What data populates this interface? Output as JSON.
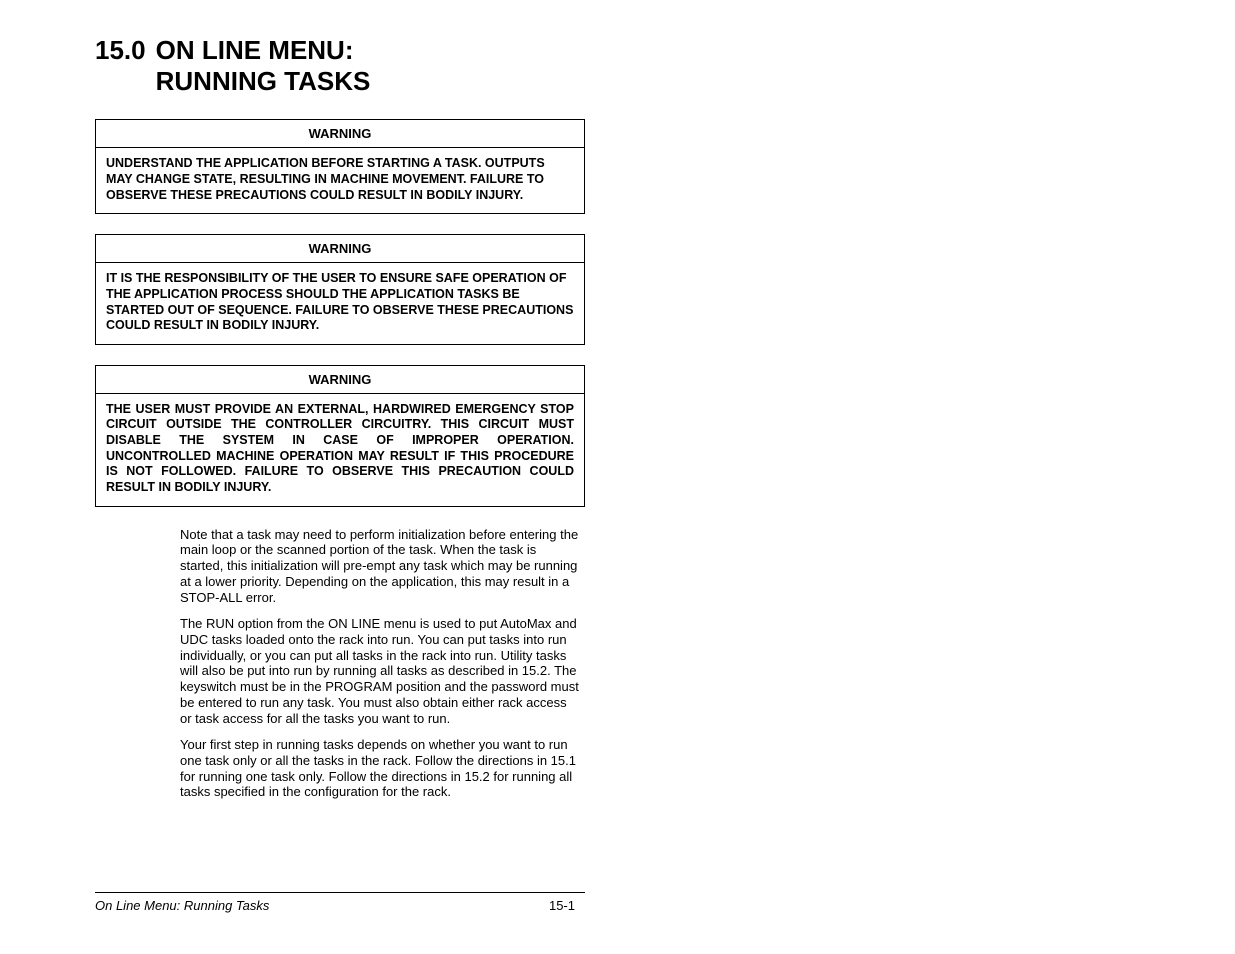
{
  "header": {
    "number": "15.0",
    "title_line1": "ON LINE MENU:",
    "title_line2": "RUNNING TASKS"
  },
  "warnings": [
    {
      "label": "WARNING",
      "text": "UNDERSTAND THE APPLICATION BEFORE STARTING A TASK. OUTPUTS MAY CHANGE STATE, RESULTING IN MACHINE MOVEMENT. FAILURE TO OBSERVE THESE PRECAUTIONS COULD RESULT IN BODILY INJURY.",
      "justify": false
    },
    {
      "label": "WARNING",
      "text": "IT IS THE RESPONSIBILITY OF THE USER TO ENSURE SAFE OPERATION OF THE APPLICATION PROCESS SHOULD THE APPLICATION TASKS BE STARTED OUT OF SEQUENCE. FAILURE TO OBSERVE THESE PRECAUTIONS COULD RESULT IN BODILY INJURY.",
      "justify": false
    },
    {
      "label": "WARNING",
      "text": "THE USER MUST PROVIDE AN EXTERNAL, HARDWIRED EMERGENCY STOP CIRCUIT OUTSIDE THE CONTROLLER CIRCUITRY. THIS CIRCUIT MUST DISABLE THE SYSTEM IN CASE OF IMPROPER OPERATION. UNCONTROLLED MACHINE OPERATION MAY RESULT IF THIS PROCEDURE IS NOT FOLLOWED. FAILURE TO OBSERVE THIS PRECAUTION COULD RESULT IN BODILY INJURY.",
      "justify": true
    }
  ],
  "paragraphs": [
    "Note that a task may need to perform initialization before entering the main loop or the scanned portion of the task. When the task is started, this initialization will pre-empt any task which may be running at a lower priority. Depending on the application, this may result in a STOP-ALL error.",
    "The RUN option from the ON LINE menu is used to put AutoMax and UDC tasks loaded onto the rack into run. You can put tasks into run individually, or you can put all tasks in the rack into run. Utility tasks will also be put into run by running all tasks as described in 15.2. The keyswitch must be in the PROGRAM position and the password must be entered to run any task. You must also obtain either rack access or task access for all the tasks you want to run.",
    "Your first step in running tasks depends on whether you want to run one task only or all the tasks in the rack. Follow the directions in 15.1 for running one task only. Follow the directions in 15.2 for running all tasks specified in the configuration for the rack."
  ],
  "footer": {
    "left": "On Line Menu: Running Tasks",
    "right": "15-1"
  }
}
